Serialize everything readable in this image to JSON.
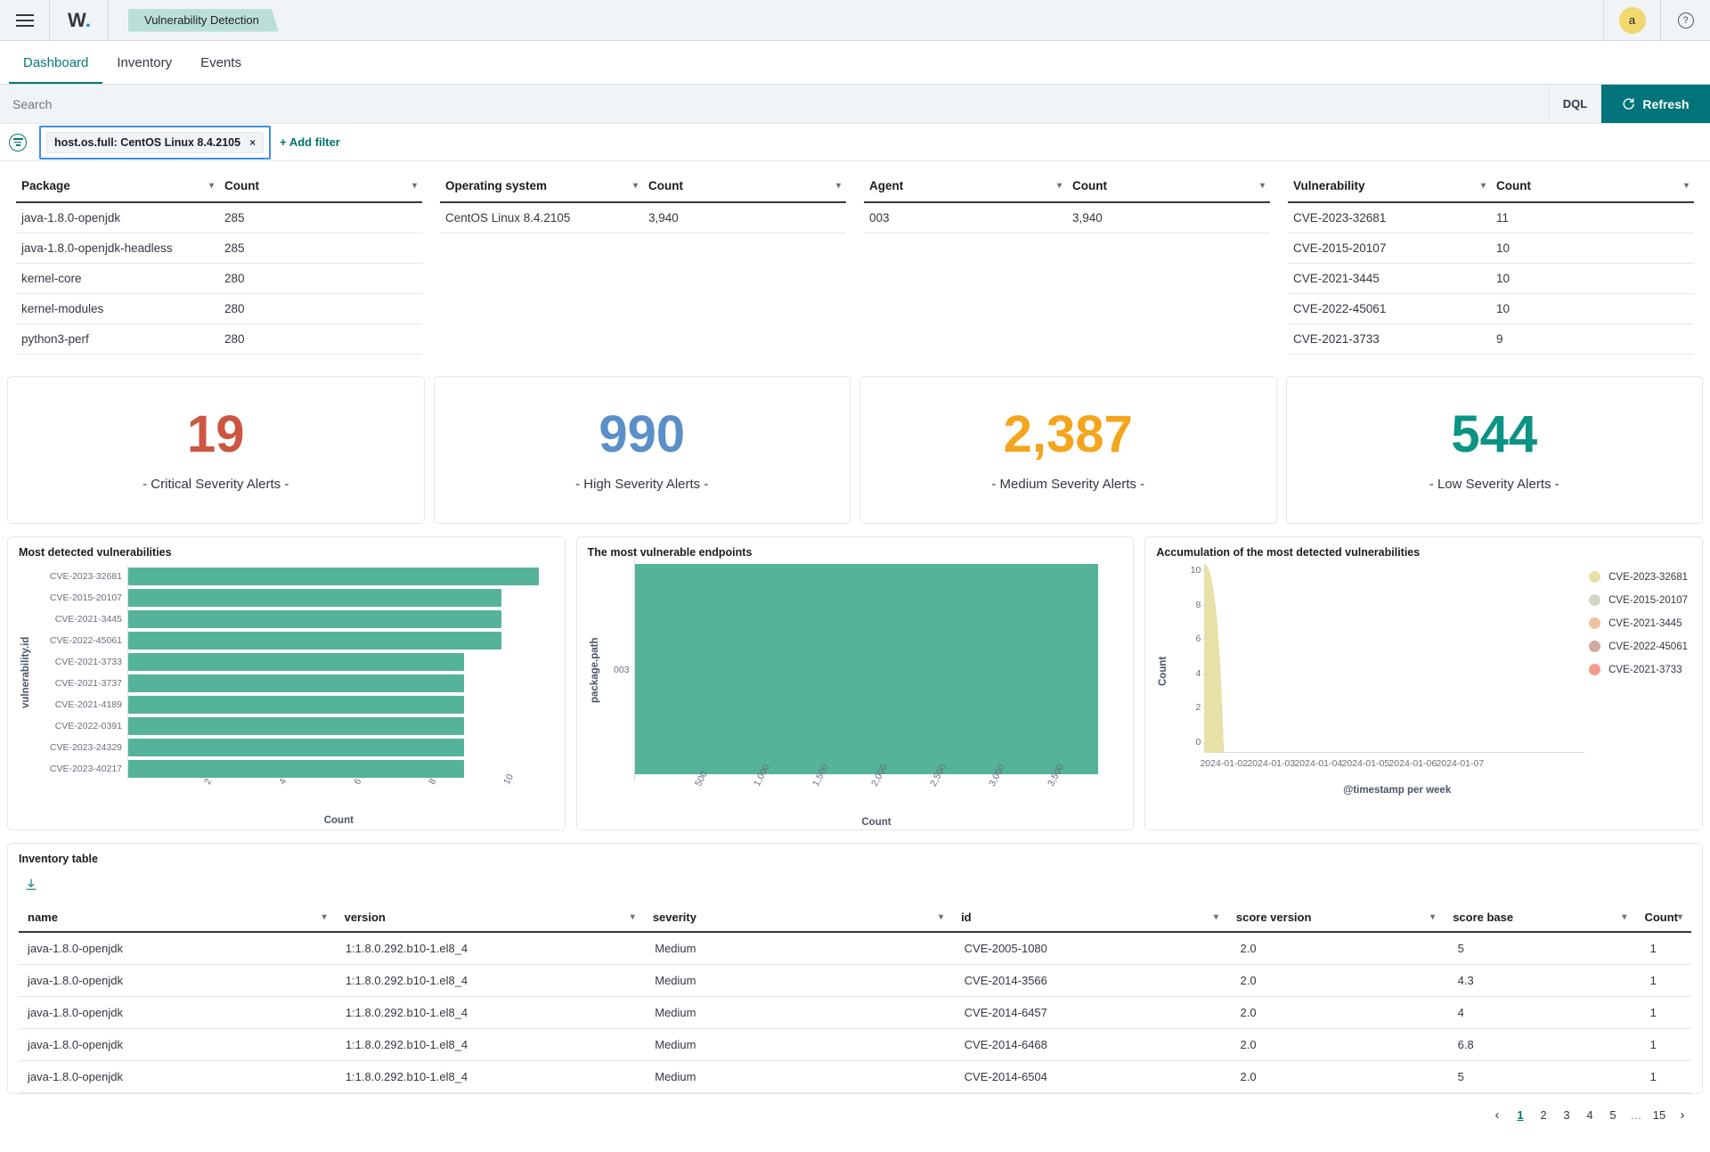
{
  "topbar": {
    "menu_icon": "hamburger-menu-icon",
    "logo_text": "W",
    "logo_dot": ".",
    "breadcrumb": "Vulnerability Detection",
    "avatar_initial": "a",
    "help_glyph": "?"
  },
  "nav": {
    "tabs": [
      {
        "label": "Dashboard",
        "active": true
      },
      {
        "label": "Inventory",
        "active": false
      },
      {
        "label": "Events",
        "active": false
      }
    ]
  },
  "search": {
    "placeholder": "Search",
    "value": "",
    "dql_label": "DQL",
    "refresh_label": "Refresh",
    "refresh_icon": "refresh-icon"
  },
  "filters": {
    "filter_icon": "filter-icon",
    "chip_label": "host.os.full: CentOS Linux 8.4.2105",
    "chip_remove": "×",
    "add_filter_label": "+ Add filter"
  },
  "summary_tables": [
    {
      "name": "package-table",
      "columns": [
        "Package",
        "Count"
      ],
      "rows": [
        [
          "java-1.8.0-openjdk",
          "285"
        ],
        [
          "java-1.8.0-openjdk-headless",
          "285"
        ],
        [
          "kernel-core",
          "280"
        ],
        [
          "kernel-modules",
          "280"
        ],
        [
          "python3-perf",
          "280"
        ]
      ]
    },
    {
      "name": "operating-system-table",
      "columns": [
        "Operating system",
        "Count"
      ],
      "rows": [
        [
          "CentOS Linux 8.4.2105",
          "3,940"
        ]
      ]
    },
    {
      "name": "agent-table",
      "columns": [
        "Agent",
        "Count"
      ],
      "rows": [
        [
          "003",
          "3,940"
        ]
      ]
    },
    {
      "name": "vulnerability-table",
      "columns": [
        "Vulnerability",
        "Count"
      ],
      "rows": [
        [
          "CVE-2023-32681",
          "11"
        ],
        [
          "CVE-2015-20107",
          "10"
        ],
        [
          "CVE-2021-3445",
          "10"
        ],
        [
          "CVE-2022-45061",
          "10"
        ],
        [
          "CVE-2021-3733",
          "9"
        ]
      ]
    }
  ],
  "kpis": [
    {
      "value": "19",
      "label": "- Critical Severity Alerts -",
      "color": "#cc5642"
    },
    {
      "value": "990",
      "label": "- High Severity Alerts -",
      "color": "#5b8fc9"
    },
    {
      "value": "2,387",
      "label": "- Medium Severity Alerts -",
      "color": "#f4a51c"
    },
    {
      "value": "544",
      "label": "- Low Severity Alerts -",
      "color": "#0b9383"
    }
  ],
  "chart_data": [
    {
      "type": "bar",
      "orientation": "horizontal",
      "name": "most-detected-vulnerabilities",
      "title": "Most detected vulnerabilities",
      "xlabel": "Count",
      "ylabel": "vulnerability.id",
      "categories": [
        "CVE-2023-32681",
        "CVE-2015-20107",
        "CVE-2021-3445",
        "CVE-2022-45061",
        "CVE-2021-3733",
        "CVE-2021-3737",
        "CVE-2021-4189",
        "CVE-2022-0391",
        "CVE-2023-24329",
        "CVE-2023-40217"
      ],
      "values": [
        11,
        10,
        10,
        10,
        9,
        9,
        9,
        9,
        9,
        9
      ],
      "xticks": [
        "2",
        "4",
        "6",
        "8",
        "10"
      ],
      "xlim": [
        0,
        11.4
      ],
      "color": "#54b399",
      "grid": false
    },
    {
      "type": "bar",
      "orientation": "horizontal",
      "name": "most-vulnerable-endpoints",
      "title": "The most vulnerable endpoints",
      "xlabel": "Count",
      "ylabel": "package.path",
      "categories": [
        "003"
      ],
      "values": [
        3940
      ],
      "xticks": [
        "500",
        "1,000",
        "1,500",
        "2,000",
        "2,500",
        "3,000",
        "3,500"
      ],
      "xlim": [
        0,
        4150
      ],
      "color": "#54b399",
      "grid": false
    },
    {
      "type": "area",
      "name": "accumulation-of-most-detected-vulnerabilities",
      "title": "Accumulation of the most detected vulnerabilities",
      "xlabel": "@timestamp per week",
      "ylabel": "Count",
      "yticks": [
        "0",
        "2",
        "4",
        "6",
        "8",
        "10"
      ],
      "ylim": [
        0,
        11
      ],
      "xticks": [
        "2024-01-02",
        "2024-01-03",
        "2024-01-04",
        "2024-01-05",
        "2024-01-06",
        "2024-01-07"
      ],
      "legend_position": "right",
      "series": [
        {
          "name": "CVE-2023-32681",
          "color": "#e7e0a7",
          "values": [
            11
          ]
        },
        {
          "name": "CVE-2015-20107",
          "color": "#d5d2c6",
          "values": [
            10
          ]
        },
        {
          "name": "CVE-2021-3445",
          "color": "#efc2a0",
          "values": [
            10
          ]
        },
        {
          "name": "CVE-2022-45061",
          "color": "#d2a9a4",
          "values": [
            10
          ]
        },
        {
          "name": "CVE-2021-3733",
          "color": "#f19b8d",
          "values": [
            9
          ]
        }
      ],
      "grid": false
    }
  ],
  "inventory": {
    "title": "Inventory table",
    "download_icon": "download-icon",
    "columns": [
      "name",
      "version",
      "severity",
      "id",
      "score version",
      "score base",
      "Count"
    ],
    "rows": [
      [
        "java-1.8.0-openjdk",
        "1:1.8.0.292.b10-1.el8_4",
        "Medium",
        "CVE-2005-1080",
        "2.0",
        "5",
        "1"
      ],
      [
        "java-1.8.0-openjdk",
        "1:1.8.0.292.b10-1.el8_4",
        "Medium",
        "CVE-2014-3566",
        "2.0",
        "4.3",
        "1"
      ],
      [
        "java-1.8.0-openjdk",
        "1:1.8.0.292.b10-1.el8_4",
        "Medium",
        "CVE-2014-6457",
        "2.0",
        "4",
        "1"
      ],
      [
        "java-1.8.0-openjdk",
        "1:1.8.0.292.b10-1.el8_4",
        "Medium",
        "CVE-2014-6468",
        "2.0",
        "6.8",
        "1"
      ],
      [
        "java-1.8.0-openjdk",
        "1:1.8.0.292.b10-1.el8_4",
        "Medium",
        "CVE-2014-6504",
        "2.0",
        "5",
        "1"
      ]
    ]
  },
  "pagination": {
    "prev": "‹",
    "next": "›",
    "pages": [
      "1",
      "2",
      "3",
      "4",
      "5",
      "…",
      "15"
    ],
    "active_page": "1"
  }
}
